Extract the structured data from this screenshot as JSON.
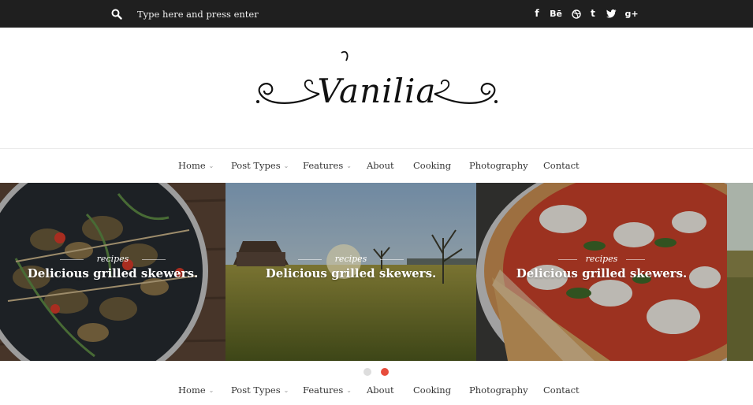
{
  "topbar": {
    "search": {
      "placeholder": "Type here and press enter",
      "icon": "search-icon"
    },
    "social": [
      {
        "name": "facebook-icon",
        "glyph": "f"
      },
      {
        "name": "behance-icon",
        "glyph": "Bē"
      },
      {
        "name": "dribbble-icon",
        "glyph": ""
      },
      {
        "name": "tumblr-icon",
        "glyph": "t"
      },
      {
        "name": "twitter-icon",
        "glyph": ""
      },
      {
        "name": "google-plus-icon",
        "glyph": "g+"
      }
    ]
  },
  "header": {
    "logo_text": "Vanilia"
  },
  "nav": {
    "items": [
      {
        "label": "Home",
        "has_dropdown": true
      },
      {
        "label": "Post Types",
        "has_dropdown": true
      },
      {
        "label": "Features",
        "has_dropdown": true
      },
      {
        "label": "About",
        "has_dropdown": false
      },
      {
        "label": "Cooking",
        "has_dropdown": false
      },
      {
        "label": "Photography",
        "has_dropdown": false
      },
      {
        "label": "Contact",
        "has_dropdown": false
      }
    ],
    "caret": "⌄"
  },
  "slider": {
    "slides": [
      {
        "category": "recipes",
        "title": "Delicious grilled skewers."
      },
      {
        "category": "recipes",
        "title": "Delicious grilled skewers."
      },
      {
        "category": "recipes",
        "title": "Delicious grilled skewers."
      }
    ],
    "active_dot": 1,
    "dot_count": 2
  },
  "colors": {
    "topbar": "#1f1f1f",
    "accent": "#e74c3c",
    "dot_inactive": "#dddddd"
  }
}
